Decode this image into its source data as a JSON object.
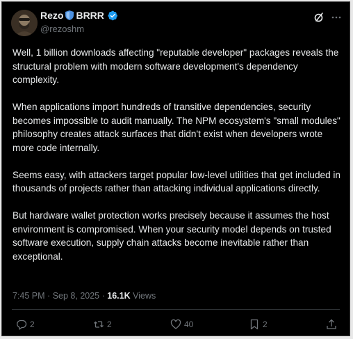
{
  "author": {
    "display_name": "Rezo",
    "display_name_suffix": "BRRR",
    "handle": "@rezoshm"
  },
  "post": {
    "paragraphs": [
      "Well, 1 billion downloads affecting \"reputable developer\" packages reveals the structural problem with modern software development's dependency complexity.",
      "When applications import hundreds of transitive dependencies, security becomes impossible to audit manually. The NPM ecosystem's \"small modules\" philosophy creates attack surfaces that didn't exist when developers wrote more code internally.",
      "Seems easy, with attackers target popular low-level utilities that get included in thousands of projects rather than attacking individual applications directly.",
      "But hardware wallet protection works precisely because it assumes the host environment is compromised. When your security model depends on trusted software execution, supply chain attacks become inevitable rather than exceptional."
    ],
    "time": "7:45 PM",
    "separator": "·",
    "date": "Sep 8, 2025",
    "views_count": "16.1K",
    "views_label": "Views"
  },
  "actions": {
    "replies": "2",
    "reposts": "2",
    "likes": "40",
    "bookmarks": "2"
  },
  "icons": {
    "header": [
      "shield-icon",
      "verified-icon",
      "grok-icon",
      "more-icon"
    ],
    "actions": [
      "reply-icon",
      "repost-icon",
      "like-icon",
      "bookmark-icon",
      "share-icon"
    ]
  },
  "colors": {
    "background": "#000000",
    "text": "#e7e9ea",
    "secondary_text": "#71767b",
    "verified": "#1d9bf0",
    "shield": "#4a8fe0"
  }
}
